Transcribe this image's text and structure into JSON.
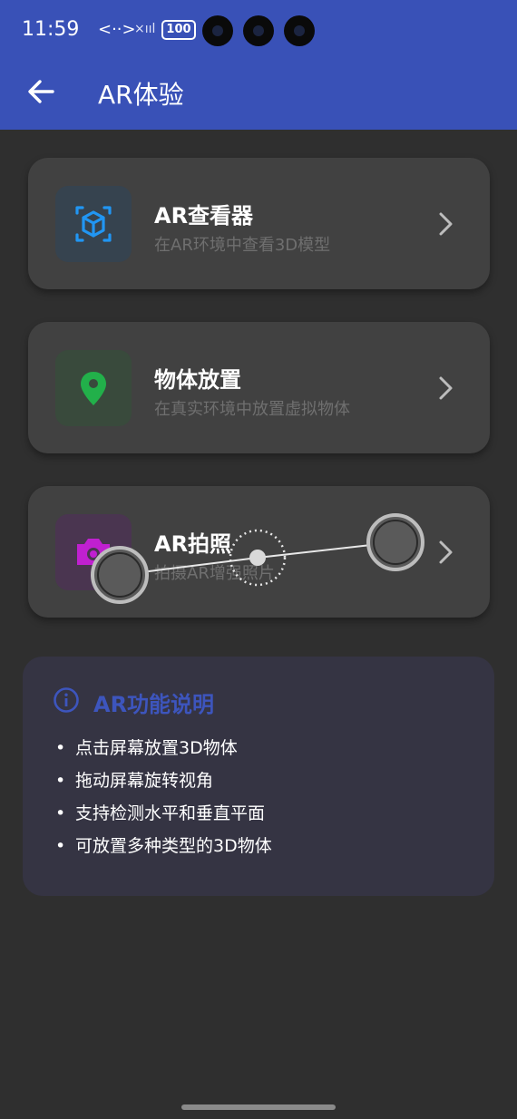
{
  "status_bar": {
    "time": "11:59",
    "network": "<··>",
    "signal": "×ııl",
    "battery": "100"
  },
  "app_bar": {
    "title": "AR体验",
    "back_icon": "arrow-left-icon"
  },
  "menu_items": [
    {
      "title": "AR查看器",
      "subtitle": "在AR环境中查看3D模型",
      "icon": "cube-scan-icon",
      "icon_color": "#2196f3"
    },
    {
      "title": "物体放置",
      "subtitle": "在真实环境中放置虚拟物体",
      "icon": "location-pin-icon",
      "icon_color": "#22b04a"
    },
    {
      "title": "AR拍照",
      "subtitle": "拍摄AR增强照片",
      "icon": "camera-icon",
      "icon_color": "#c020d0"
    }
  ],
  "info_card": {
    "title": "AR功能说明",
    "icon": "info-icon",
    "accent_color": "#3d55bd",
    "bullets": [
      "点击屏幕放置3D物体",
      "拖动屏幕旋转视角",
      "支持检测水平和垂直平面",
      "可放置多种类型的3D物体"
    ]
  }
}
